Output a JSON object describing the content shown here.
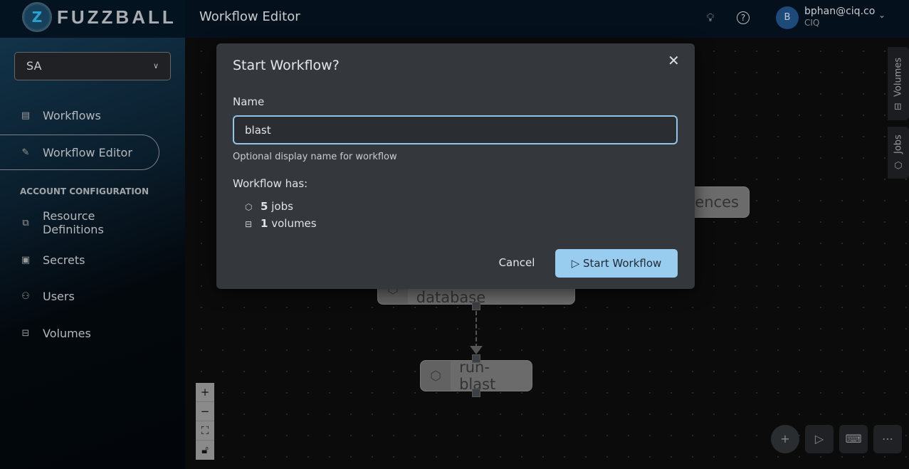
{
  "header": {
    "brand": "FUZZBALL",
    "page_title": "Workflow Editor",
    "user_initial": "B",
    "user_email": "bphan@ciq.co",
    "user_org": "CIQ"
  },
  "sidebar": {
    "account_select": "SA",
    "items": [
      {
        "label": "Workflows",
        "icon": "list-icon"
      },
      {
        "label": "Workflow Editor",
        "icon": "edit-icon",
        "active": true
      }
    ],
    "section_title": "ACCOUNT CONFIGURATION",
    "config_items": [
      {
        "label": "Resource Definitions",
        "icon": "hierarchy-icon"
      },
      {
        "label": "Secrets",
        "icon": "secret-icon"
      },
      {
        "label": "Users",
        "icon": "users-icon"
      },
      {
        "label": "Volumes",
        "icon": "drive-icon"
      }
    ]
  },
  "canvas": {
    "nodes": [
      {
        "label": "uences"
      },
      {
        "label": "make-blast-database"
      },
      {
        "label": "run-blast"
      }
    ],
    "side_tabs": [
      "Volumes",
      "Jobs"
    ]
  },
  "modal": {
    "title": "Start Workflow?",
    "name_label": "Name",
    "name_value": "blast",
    "help": "Optional display name for workflow",
    "has_label": "Workflow has:",
    "jobs_count": "5",
    "jobs_label": "jobs",
    "volumes_count": "1",
    "volumes_label": "volumes",
    "cancel": "Cancel",
    "start": "Start Workflow",
    "start_color": "#99cdf0"
  }
}
